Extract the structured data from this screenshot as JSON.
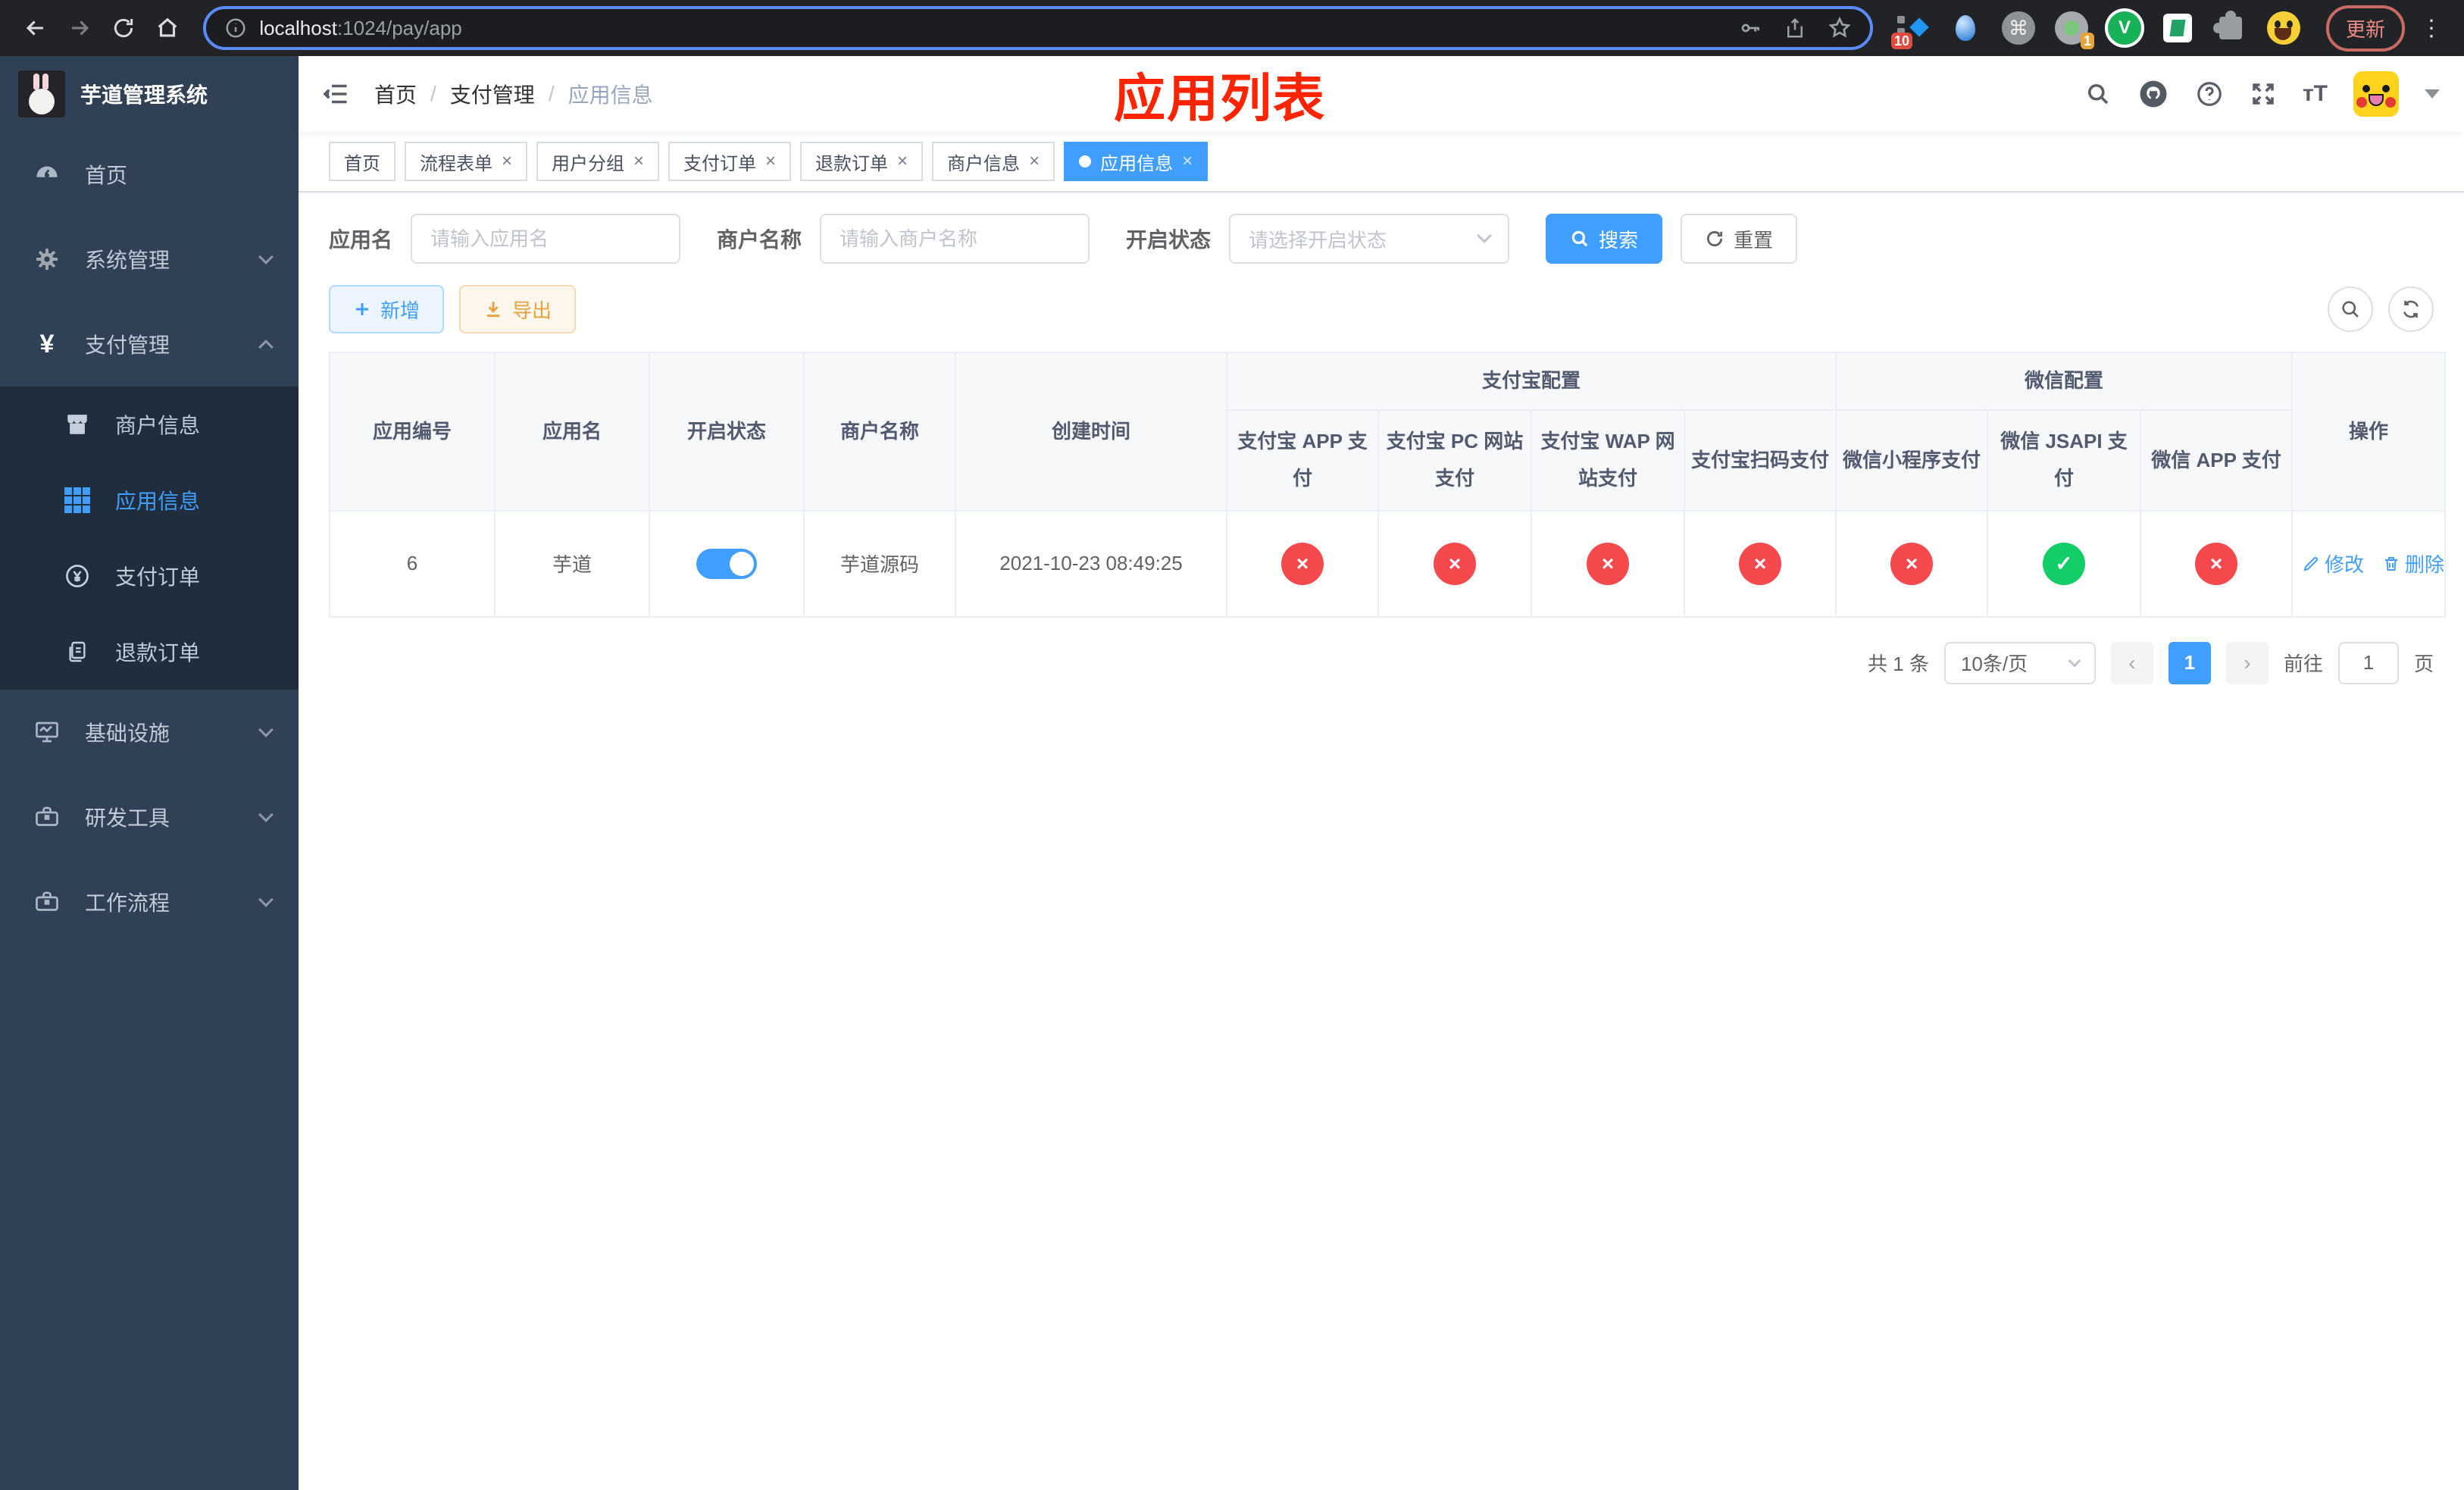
{
  "browser": {
    "url": {
      "host": "localhost",
      "path": ":1024/pay/app"
    },
    "update_button": "更新",
    "extension_badges": {
      "pin_badge": "10",
      "session_badge": "1"
    },
    "vlogo_letter": "V"
  },
  "sidebar": {
    "logo_title": "芋道管理系统",
    "items": [
      {
        "label": "首页",
        "state": ""
      },
      {
        "label": "系统管理",
        "state": ""
      },
      {
        "label": "支付管理",
        "state": "expanded"
      },
      {
        "label": "商户信息",
        "state": ""
      },
      {
        "label": "应用信息",
        "state": "active"
      },
      {
        "label": "支付订单",
        "state": ""
      },
      {
        "label": "退款订单",
        "state": ""
      },
      {
        "label": "基础设施",
        "state": ""
      },
      {
        "label": "研发工具",
        "state": ""
      },
      {
        "label": "工作流程",
        "state": ""
      }
    ]
  },
  "navbar": {
    "breadcrumb": {
      "home": "首页",
      "section": "支付管理",
      "current": "应用信息",
      "separator": "/"
    },
    "title_overlay": "应用列表"
  },
  "tabs": [
    {
      "label": "首页",
      "state": ""
    },
    {
      "label": "流程表单",
      "state": ""
    },
    {
      "label": "用户分组",
      "state": ""
    },
    {
      "label": "支付订单",
      "state": ""
    },
    {
      "label": "退款订单",
      "state": ""
    },
    {
      "label": "商户信息",
      "state": ""
    },
    {
      "label": "应用信息",
      "state": "active"
    }
  ],
  "close_glyph": "×",
  "filters": {
    "app_name_label": "应用名",
    "app_name_placeholder": "请输入应用名",
    "merchant_label": "商户名称",
    "merchant_placeholder": "请输入商户名称",
    "status_label": "开启状态",
    "status_placeholder": "请选择开启状态",
    "search_button": "搜索",
    "reset_button": "重置"
  },
  "toolbar": {
    "add_button": "新增",
    "export_button": "导出"
  },
  "table": {
    "simple_headers": [
      "应用编号",
      "应用名",
      "开启状态",
      "商户名称",
      "创建时间"
    ],
    "groups": [
      {
        "label": "支付宝配置",
        "children": [
          "支付宝 APP 支付",
          "支付宝 PC 网站支付",
          "支付宝 WAP 网站支付",
          "支付宝扫码支付"
        ]
      },
      {
        "label": "微信配置",
        "children": [
          "微信小程序支付",
          "微信 JSAPI 支付",
          "微信 APP 支付"
        ]
      }
    ],
    "action_header": "操作",
    "row": {
      "id": "6",
      "name": "芋道",
      "switch_state": "on",
      "merchant": "芋道源码",
      "created": "2021-10-23 08:49:25",
      "channels": [
        {
          "state": "fail",
          "glyph": "×"
        },
        {
          "state": "fail",
          "glyph": "×"
        },
        {
          "state": "fail",
          "glyph": "×"
        },
        {
          "state": "fail",
          "glyph": "×"
        },
        {
          "state": "fail",
          "glyph": "×"
        },
        {
          "state": "success",
          "glyph": "✓"
        },
        {
          "state": "fail",
          "glyph": "×"
        }
      ],
      "edit_link": "修改",
      "delete_link": "删除"
    }
  },
  "pagination": {
    "total": "共 1 条",
    "page_size": "10条/页",
    "current_page": "1",
    "goto_label": "前往",
    "goto_value": "1",
    "page_unit": "页"
  },
  "colors": {
    "accent": "#409eff",
    "danger": "#f5494d",
    "success": "#13ce66",
    "warning": "#e6a23c"
  }
}
